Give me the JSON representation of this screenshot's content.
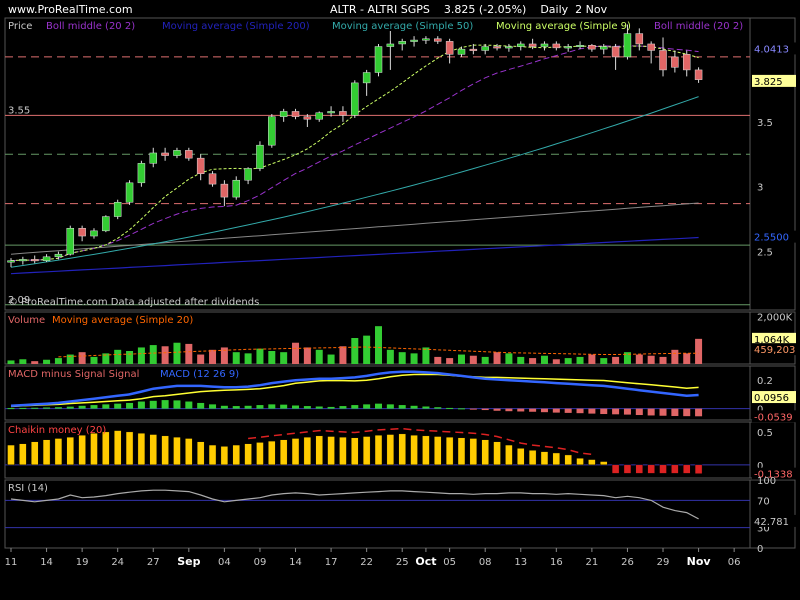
{
  "header": {
    "site": "www.ProRealTime.com",
    "symbol": "ALTR - ALTRI SGPS",
    "price_change": "3.825 (-2.05%)",
    "period": "Daily",
    "date": "2 Nov"
  },
  "colors": {
    "background": "#000000",
    "grid": "#2a2a2a",
    "candle_up": "#33cc33",
    "candle_down": "#e06666",
    "ma9": "#ccff66",
    "ma50": "#33aaaa",
    "ma200": "#2222bb",
    "boll": "#9933cc",
    "volume_ma": "#ff6600",
    "macd_line": "#3366ff",
    "signal_line": "#ffff33",
    "chaikin": "#ffcc00",
    "rsi": "#aaaaaa"
  },
  "chart_data": [
    {
      "type": "candlestick",
      "panel": "price",
      "legend": [
        "Price",
        "Boll middle (20 2)",
        "Moving average (Simple 200)",
        "Moving average (Simple 50)",
        "Moving average (Simple 9)",
        "Boll middle (20 2)"
      ],
      "y_ticks": [
        "3.55",
        "3.5",
        "3",
        "2.5",
        "2.09"
      ],
      "y_range": [
        2.05,
        4.3
      ],
      "price_boxes": [
        "4.0413",
        "3.825",
        "2.5500"
      ],
      "note": "© ProRealTime.com  Data adjusted after dividends",
      "hlines": [
        {
          "value": 3.55,
          "color": "#e07070",
          "style": "solid"
        },
        {
          "value": 3.25,
          "color": "#669966",
          "style": "dash"
        },
        {
          "value": 2.87,
          "color": "#e07070",
          "style": "dash"
        },
        {
          "value": 4.0,
          "color": "#e07070",
          "style": "dash"
        },
        {
          "value": 2.55,
          "color": "#669966",
          "style": "solid"
        },
        {
          "value": 2.09,
          "color": "#669966",
          "style": "solid"
        }
      ],
      "candles": [
        {
          "o": 2.42,
          "h": 2.45,
          "l": 2.38,
          "c": 2.43
        },
        {
          "o": 2.43,
          "h": 2.46,
          "l": 2.4,
          "c": 2.44
        },
        {
          "o": 2.44,
          "h": 2.47,
          "l": 2.41,
          "c": 2.43
        },
        {
          "o": 2.43,
          "h": 2.48,
          "l": 2.42,
          "c": 2.46
        },
        {
          "o": 2.46,
          "h": 2.5,
          "l": 2.44,
          "c": 2.48
        },
        {
          "o": 2.48,
          "h": 2.7,
          "l": 2.47,
          "c": 2.68
        },
        {
          "o": 2.68,
          "h": 2.7,
          "l": 2.58,
          "c": 2.62
        },
        {
          "o": 2.62,
          "h": 2.68,
          "l": 2.6,
          "c": 2.66
        },
        {
          "o": 2.66,
          "h": 2.78,
          "l": 2.65,
          "c": 2.77
        },
        {
          "o": 2.77,
          "h": 2.9,
          "l": 2.75,
          "c": 2.88
        },
        {
          "o": 2.88,
          "h": 3.05,
          "l": 2.86,
          "c": 3.03
        },
        {
          "o": 3.03,
          "h": 3.2,
          "l": 3.0,
          "c": 3.18
        },
        {
          "o": 3.18,
          "h": 3.3,
          "l": 3.15,
          "c": 3.26
        },
        {
          "o": 3.26,
          "h": 3.3,
          "l": 3.2,
          "c": 3.24
        },
        {
          "o": 3.24,
          "h": 3.3,
          "l": 3.22,
          "c": 3.28
        },
        {
          "o": 3.28,
          "h": 3.3,
          "l": 3.2,
          "c": 3.22
        },
        {
          "o": 3.22,
          "h": 3.25,
          "l": 3.05,
          "c": 3.1
        },
        {
          "o": 3.1,
          "h": 3.12,
          "l": 3.0,
          "c": 3.02
        },
        {
          "o": 3.02,
          "h": 3.05,
          "l": 2.85,
          "c": 2.92
        },
        {
          "o": 2.92,
          "h": 3.08,
          "l": 2.9,
          "c": 3.05
        },
        {
          "o": 3.05,
          "h": 3.15,
          "l": 3.02,
          "c": 3.14
        },
        {
          "o": 3.14,
          "h": 3.35,
          "l": 3.12,
          "c": 3.32
        },
        {
          "o": 3.32,
          "h": 3.56,
          "l": 3.3,
          "c": 3.54
        },
        {
          "o": 3.54,
          "h": 3.6,
          "l": 3.5,
          "c": 3.58
        },
        {
          "o": 3.58,
          "h": 3.6,
          "l": 3.52,
          "c": 3.54
        },
        {
          "o": 3.54,
          "h": 3.56,
          "l": 3.46,
          "c": 3.52
        },
        {
          "o": 3.52,
          "h": 3.58,
          "l": 3.5,
          "c": 3.57
        },
        {
          "o": 3.57,
          "h": 3.62,
          "l": 3.54,
          "c": 3.58
        },
        {
          "o": 3.58,
          "h": 3.62,
          "l": 3.5,
          "c": 3.55
        },
        {
          "o": 3.55,
          "h": 3.82,
          "l": 3.53,
          "c": 3.8
        },
        {
          "o": 3.8,
          "h": 3.9,
          "l": 3.7,
          "c": 3.88
        },
        {
          "o": 3.88,
          "h": 4.1,
          "l": 3.85,
          "c": 4.08
        },
        {
          "o": 4.08,
          "h": 4.2,
          "l": 3.9,
          "c": 4.1
        },
        {
          "o": 4.1,
          "h": 4.14,
          "l": 4.05,
          "c": 4.12
        },
        {
          "o": 4.12,
          "h": 4.16,
          "l": 4.08,
          "c": 4.13
        },
        {
          "o": 4.13,
          "h": 4.16,
          "l": 4.1,
          "c": 4.14
        },
        {
          "o": 4.14,
          "h": 4.16,
          "l": 4.1,
          "c": 4.12
        },
        {
          "o": 4.12,
          "h": 4.14,
          "l": 3.95,
          "c": 4.02
        },
        {
          "o": 4.02,
          "h": 4.08,
          "l": 4.0,
          "c": 4.06
        },
        {
          "o": 4.06,
          "h": 4.1,
          "l": 4.02,
          "c": 4.05
        },
        {
          "o": 4.05,
          "h": 4.1,
          "l": 4.02,
          "c": 4.08
        },
        {
          "o": 4.08,
          "h": 4.1,
          "l": 4.05,
          "c": 4.07
        },
        {
          "o": 4.07,
          "h": 4.1,
          "l": 4.04,
          "c": 4.08
        },
        {
          "o": 4.08,
          "h": 4.12,
          "l": 4.05,
          "c": 4.1
        },
        {
          "o": 4.1,
          "h": 4.14,
          "l": 4.06,
          "c": 4.08
        },
        {
          "o": 4.08,
          "h": 4.12,
          "l": 4.05,
          "c": 4.1
        },
        {
          "o": 4.1,
          "h": 4.12,
          "l": 4.05,
          "c": 4.07
        },
        {
          "o": 4.07,
          "h": 4.1,
          "l": 4.04,
          "c": 4.08
        },
        {
          "o": 4.08,
          "h": 4.12,
          "l": 4.06,
          "c": 4.09
        },
        {
          "o": 4.09,
          "h": 4.1,
          "l": 4.04,
          "c": 4.06
        },
        {
          "o": 4.06,
          "h": 4.1,
          "l": 4.02,
          "c": 4.08
        },
        {
          "o": 4.08,
          "h": 4.1,
          "l": 3.9,
          "c": 4.0
        },
        {
          "o": 4.0,
          "h": 4.25,
          "l": 3.98,
          "c": 4.18
        },
        {
          "o": 4.18,
          "h": 4.22,
          "l": 4.05,
          "c": 4.1
        },
        {
          "o": 4.1,
          "h": 4.12,
          "l": 3.95,
          "c": 4.05
        },
        {
          "o": 4.05,
          "h": 4.15,
          "l": 3.85,
          "c": 3.9
        },
        {
          "o": 4.0,
          "h": 4.05,
          "l": 3.88,
          "c": 3.92
        },
        {
          "o": 4.02,
          "h": 4.05,
          "l": 3.85,
          "c": 3.9
        },
        {
          "o": 3.9,
          "h": 3.92,
          "l": 3.8,
          "c": 3.825
        }
      ]
    },
    {
      "type": "bar",
      "panel": "volume",
      "legend": [
        "Volume",
        "Moving average (Simple 20)"
      ],
      "y_ticks": [
        "2,000K"
      ],
      "y_range": [
        0,
        2200
      ],
      "value_boxes": [
        "1,064K",
        "459,203"
      ],
      "values": [
        150,
        200,
        120,
        180,
        250,
        400,
        500,
        300,
        450,
        600,
        550,
        700,
        800,
        750,
        900,
        850,
        400,
        600,
        700,
        500,
        450,
        650,
        550,
        500,
        900,
        700,
        600,
        400,
        750,
        1100,
        1200,
        1600,
        600,
        500,
        450,
        700,
        300,
        250,
        400,
        350,
        300,
        500,
        450,
        300,
        250,
        350,
        200,
        250,
        300,
        400,
        250,
        300,
        500,
        400,
        350,
        300,
        600,
        450,
        1064
      ],
      "ma_values": [
        300,
        320,
        340,
        360,
        380,
        400,
        420,
        440,
        460,
        480,
        500,
        520,
        540,
        560,
        580,
        600,
        620,
        630,
        640,
        650,
        660,
        670,
        680,
        690,
        700,
        710,
        720,
        700,
        680,
        660,
        640,
        620,
        600,
        580,
        560,
        540,
        520,
        500,
        480,
        470,
        460,
        450,
        440,
        430,
        420,
        410,
        400,
        400,
        410,
        420,
        430,
        440,
        450,
        455,
        459
      ]
    },
    {
      "type": "bar",
      "panel": "macd",
      "legend": [
        "MACD minus Signal Signal",
        "MACD (12 26 9)"
      ],
      "y_ticks": [
        "0.2",
        "0.1",
        "0"
      ],
      "y_range": [
        -0.08,
        0.3
      ],
      "value_boxes": [
        "0.0956",
        "-0.0539"
      ],
      "histogram": [
        0.004,
        0.005,
        0.006,
        0.008,
        0.01,
        0.014,
        0.02,
        0.025,
        0.03,
        0.035,
        0.04,
        0.05,
        0.055,
        0.06,
        0.058,
        0.05,
        0.04,
        0.03,
        0.02,
        0.018,
        0.02,
        0.025,
        0.03,
        0.028,
        0.022,
        0.018,
        0.015,
        0.012,
        0.018,
        0.025,
        0.03,
        0.035,
        0.03,
        0.025,
        0.02,
        0.015,
        0.01,
        0.005,
        0.002,
        -0.005,
        -0.01,
        -0.015,
        -0.018,
        -0.02,
        -0.022,
        -0.025,
        -0.028,
        -0.03,
        -0.032,
        -0.035,
        -0.038,
        -0.04,
        -0.042,
        -0.045,
        -0.048,
        -0.05,
        -0.052,
        -0.053,
        -0.0539
      ],
      "macd": [
        0.02,
        0.025,
        0.03,
        0.035,
        0.04,
        0.05,
        0.06,
        0.07,
        0.08,
        0.09,
        0.1,
        0.12,
        0.14,
        0.15,
        0.16,
        0.16,
        0.16,
        0.155,
        0.15,
        0.15,
        0.155,
        0.165,
        0.18,
        0.19,
        0.2,
        0.205,
        0.21,
        0.21,
        0.215,
        0.22,
        0.23,
        0.245,
        0.255,
        0.26,
        0.26,
        0.255,
        0.25,
        0.24,
        0.23,
        0.22,
        0.21,
        0.205,
        0.2,
        0.195,
        0.19,
        0.185,
        0.18,
        0.175,
        0.17,
        0.165,
        0.16,
        0.15,
        0.14,
        0.13,
        0.12,
        0.11,
        0.1,
        0.09,
        0.0956
      ],
      "signal": [
        0.015,
        0.02,
        0.024,
        0.027,
        0.03,
        0.036,
        0.04,
        0.045,
        0.05,
        0.055,
        0.06,
        0.07,
        0.085,
        0.09,
        0.1,
        0.11,
        0.12,
        0.125,
        0.13,
        0.132,
        0.135,
        0.14,
        0.15,
        0.162,
        0.178,
        0.187,
        0.195,
        0.198,
        0.197,
        0.195,
        0.2,
        0.21,
        0.225,
        0.235,
        0.24,
        0.24,
        0.24,
        0.235,
        0.228,
        0.225,
        0.22,
        0.22,
        0.218,
        0.215,
        0.212,
        0.21,
        0.208,
        0.205,
        0.202,
        0.2,
        0.198,
        0.19,
        0.182,
        0.175,
        0.168,
        0.16,
        0.152,
        0.143,
        0.1495
      ]
    },
    {
      "type": "bar",
      "panel": "chaikin",
      "legend": [
        "Chaikin money (20)"
      ],
      "y_ticks": [
        "0.5",
        "0"
      ],
      "y_range": [
        -0.2,
        0.65
      ],
      "value_boxes": [
        "-0.1338"
      ],
      "values": [
        0.3,
        0.32,
        0.35,
        0.38,
        0.4,
        0.42,
        0.45,
        0.48,
        0.5,
        0.52,
        0.5,
        0.48,
        0.46,
        0.44,
        0.42,
        0.4,
        0.35,
        0.3,
        0.28,
        0.3,
        0.32,
        0.34,
        0.36,
        0.38,
        0.4,
        0.42,
        0.44,
        0.43,
        0.42,
        0.41,
        0.43,
        0.45,
        0.46,
        0.47,
        0.45,
        0.44,
        0.43,
        0.42,
        0.41,
        0.4,
        0.38,
        0.35,
        0.3,
        0.25,
        0.22,
        0.2,
        0.18,
        0.15,
        0.1,
        0.08,
        0.05,
        -0.13,
        -0.13,
        -0.13,
        -0.13,
        -0.13,
        -0.13,
        -0.13,
        -0.1338
      ]
    },
    {
      "type": "line",
      "panel": "rsi",
      "legend": [
        "RSI (14)"
      ],
      "y_ticks": [
        "100",
        "70",
        "30",
        "0"
      ],
      "y_range": [
        0,
        100
      ],
      "value_boxes": [
        "42.781"
      ],
      "values": [
        72,
        70,
        68,
        70,
        72,
        78,
        74,
        75,
        77,
        80,
        82,
        84,
        85,
        85,
        84,
        83,
        78,
        72,
        68,
        70,
        72,
        74,
        78,
        80,
        81,
        80,
        78,
        79,
        80,
        81,
        82,
        83,
        84,
        84,
        83,
        82,
        81,
        80,
        80,
        79,
        80,
        80,
        81,
        81,
        80,
        80,
        79,
        80,
        79,
        78,
        77,
        74,
        76,
        74,
        70,
        60,
        55,
        52,
        42.781
      ]
    }
  ],
  "x_axis": {
    "labels": [
      "11",
      "14",
      "19",
      "24",
      "27",
      "Sep",
      "04",
      "09",
      "14",
      "17",
      "22",
      "25",
      "Oct",
      "05",
      "08",
      "13",
      "16",
      "21",
      "26",
      "29",
      "Nov",
      "06"
    ],
    "label_index": [
      0,
      3,
      6,
      9,
      12,
      15,
      18,
      21,
      24,
      27,
      30,
      33,
      35,
      37,
      40,
      43,
      46,
      49,
      52,
      55,
      58,
      61
    ]
  }
}
